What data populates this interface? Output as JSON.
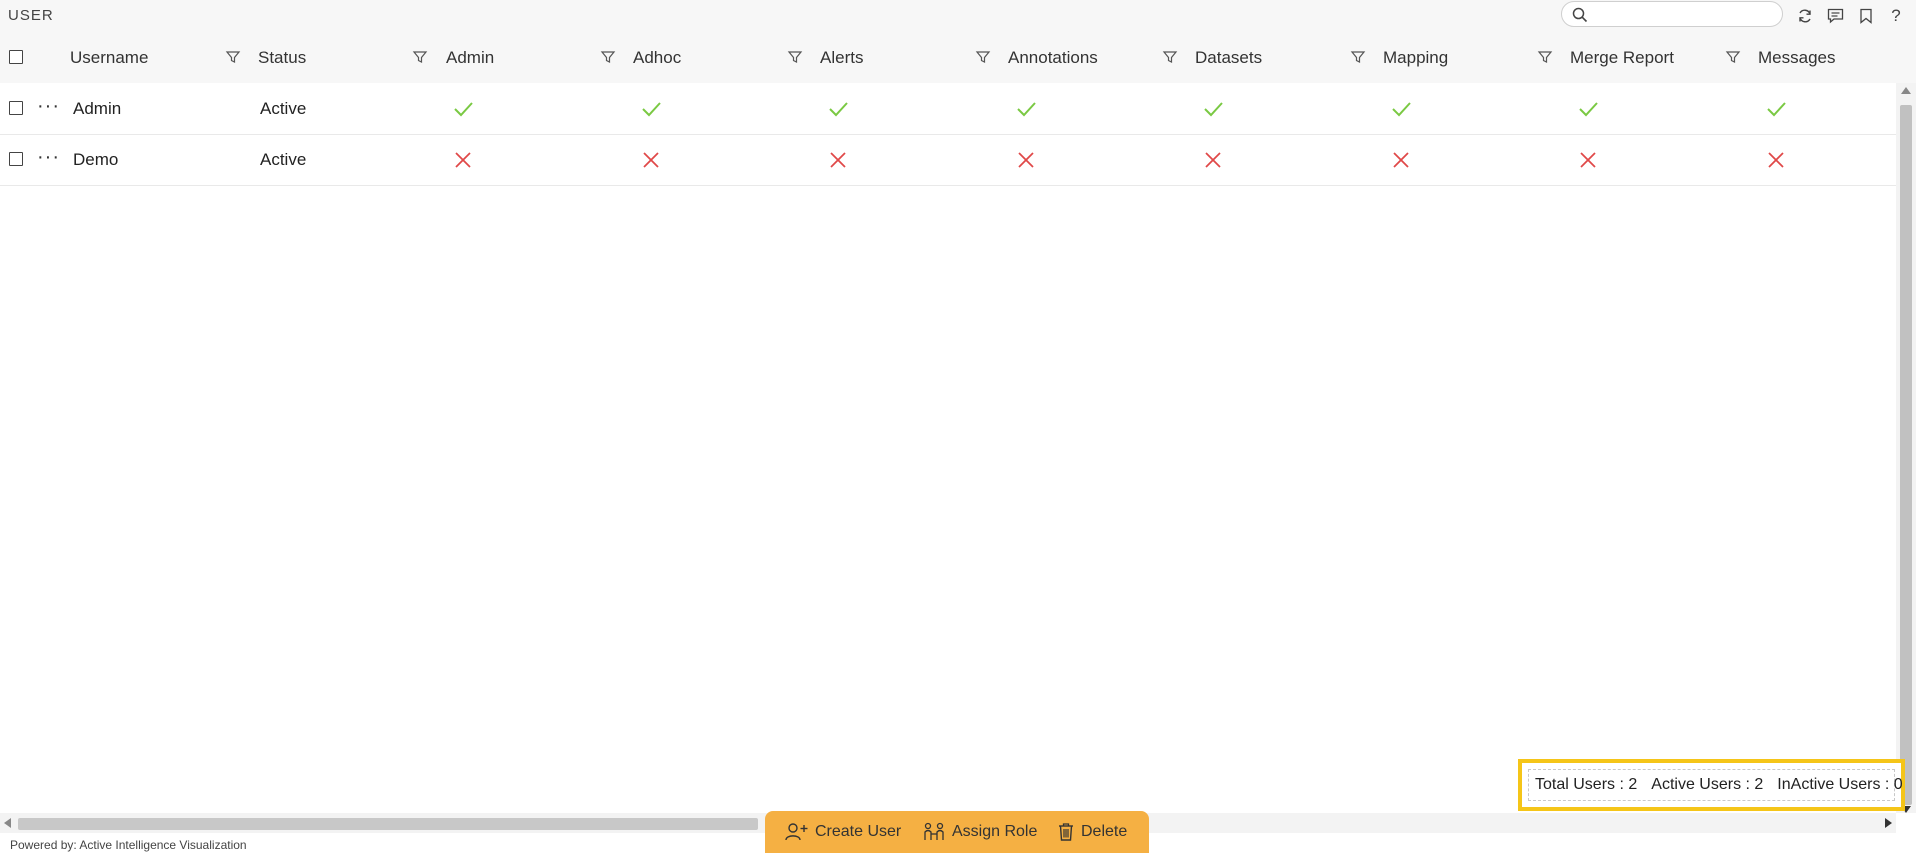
{
  "page": {
    "title": "USER"
  },
  "toolbar": {
    "search_placeholder": "",
    "icons": [
      "refresh-icon",
      "comment-icon",
      "bookmark-icon",
      "help-icon"
    ],
    "help_glyph": "?"
  },
  "grid": {
    "columns": [
      "Username",
      "Status",
      "Admin",
      "Adhoc",
      "Alerts",
      "Annotations",
      "Datasets",
      "Mapping",
      "Merge Report",
      "Messages"
    ],
    "rows": [
      {
        "menu": "···",
        "username": "Admin",
        "status": "Active",
        "permissions": [
          true,
          true,
          true,
          true,
          true,
          true,
          true,
          true
        ]
      },
      {
        "menu": "···",
        "username": "Demo",
        "status": "Active",
        "permissions": [
          false,
          false,
          false,
          false,
          false,
          false,
          false,
          false
        ]
      }
    ]
  },
  "summary": {
    "total": "Total Users : 2",
    "active": "Active Users : 2",
    "inactive": "InActive Users : 0"
  },
  "actions": {
    "create_user": "Create User",
    "assign_role": "Assign Role",
    "delete": "Delete"
  },
  "footer": {
    "text": "Powered by: Active Intelligence Visualization"
  },
  "colors": {
    "check": "#7ac943",
    "cross": "#e04848",
    "accent": "#f5b043",
    "highlight": "#f5c518"
  }
}
